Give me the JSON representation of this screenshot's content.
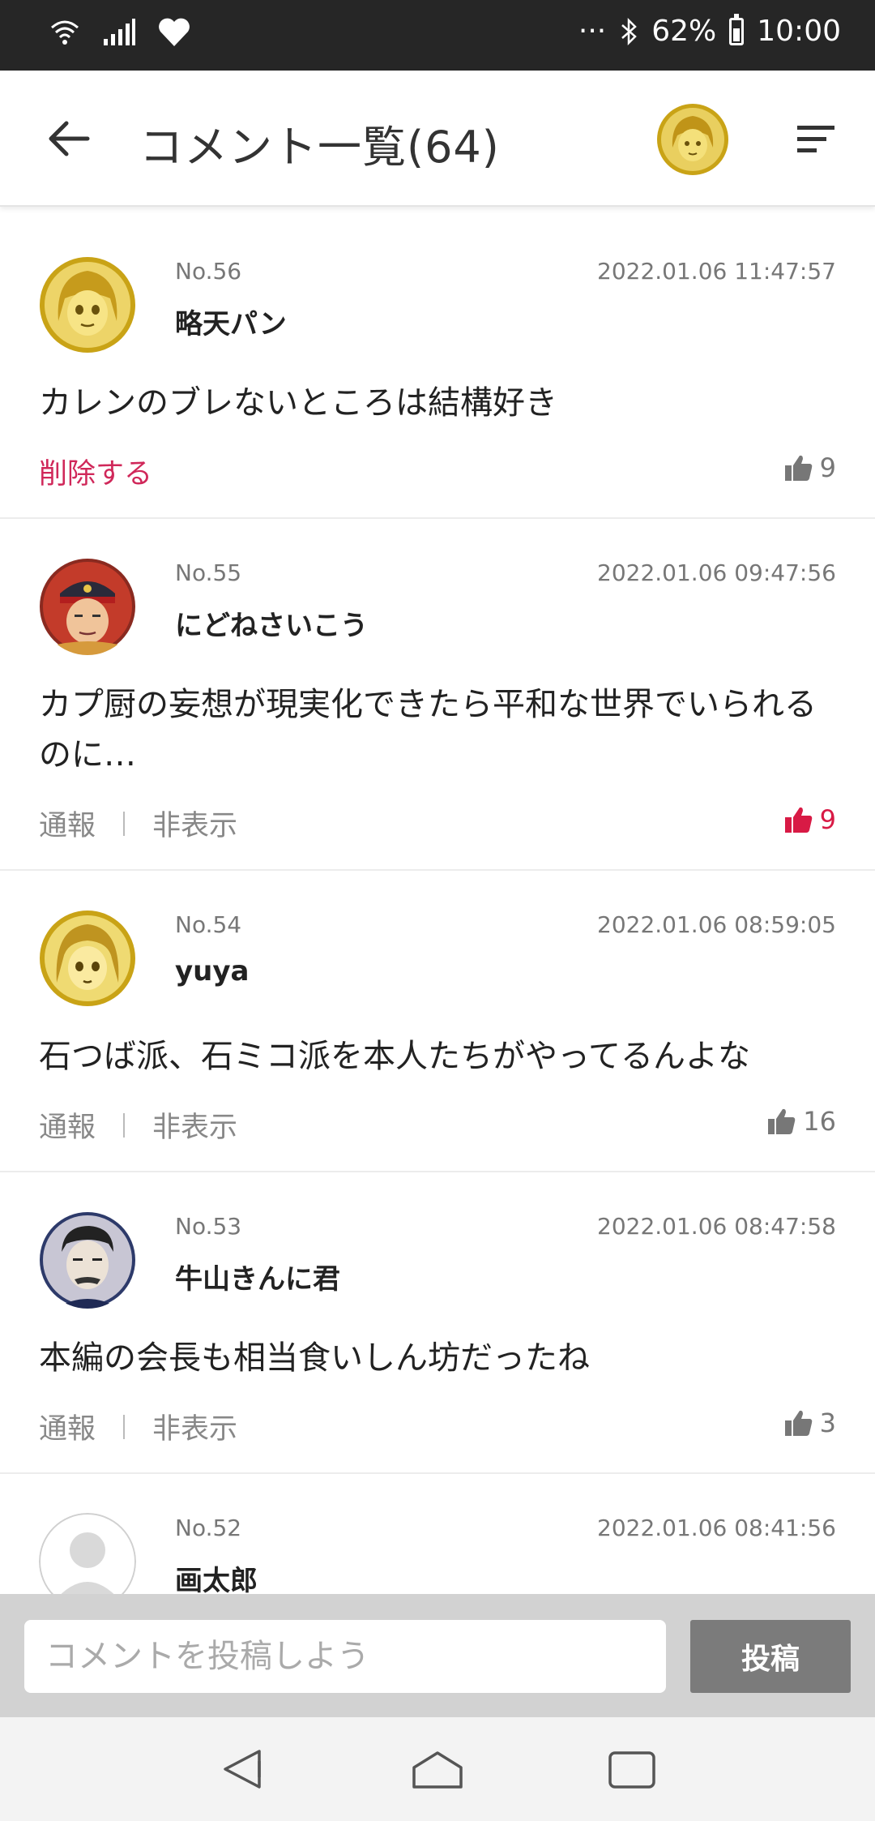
{
  "status_bar": {
    "dots": "···",
    "battery_percent": "62%",
    "time": "10:00"
  },
  "header": {
    "title": "コメント一覧(64)"
  },
  "comments": [
    {
      "number": "No.56",
      "date": "2022.01.06 11:47:57",
      "user": "略天パン",
      "text": "カレンのブレないところは結構好き",
      "delete_label": "削除する",
      "likes": "9",
      "liked": false,
      "avatar": "blonde-anime-avatar"
    },
    {
      "number": "No.55",
      "date": "2022.01.06 09:47:56",
      "user": "にどねさいこう",
      "text": "カプ厨の妄想が現実化できたら平和な世界でいられるのに…",
      "report_label": "通報",
      "hide_label": "非表示",
      "likes": "9",
      "liked": true,
      "avatar": "soldier-anime-avatar"
    },
    {
      "number": "No.54",
      "date": "2022.01.06 08:59:05",
      "user": "yuya",
      "text": "石つば派、石ミコ派を本人たちがやってるんよな",
      "report_label": "通報",
      "hide_label": "非表示",
      "likes": "16",
      "liked": false,
      "avatar": "girl-anime-avatar"
    },
    {
      "number": "No.53",
      "date": "2022.01.06 08:47:58",
      "user": "牛山きんに君",
      "text": "本編の会長も相当食いしん坊だったね",
      "report_label": "通報",
      "hide_label": "非表示",
      "likes": "3",
      "liked": false,
      "avatar": "man-anime-avatar"
    },
    {
      "number": "No.52",
      "date": "2022.01.06 08:41:56",
      "user": "画太郎",
      "avatar": "default-user-avatar"
    }
  ],
  "input": {
    "placeholder": "コメントを投稿しよう",
    "submit_label": "投稿"
  },
  "colors": {
    "accent": "#d81a45",
    "delete": "#d0285a",
    "status_bar": "#262626"
  }
}
